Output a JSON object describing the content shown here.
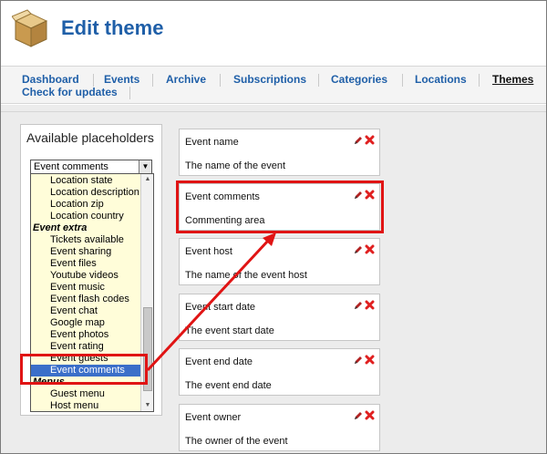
{
  "header": {
    "title": "Edit theme",
    "icon": "box-icon"
  },
  "nav": {
    "items": [
      {
        "label": "Dashboard"
      },
      {
        "label": "Events"
      },
      {
        "label": "Archive"
      },
      {
        "label": "Subscriptions"
      },
      {
        "label": "Categories"
      },
      {
        "label": "Locations"
      },
      {
        "label": "Themes"
      },
      {
        "label": "Check for updates"
      }
    ],
    "active": "Themes"
  },
  "placeholders": {
    "title": "Available placeholders",
    "selected_value": "Event comments",
    "dropdown_items": [
      {
        "label": "Location state",
        "group": false
      },
      {
        "label": "Location description",
        "group": false
      },
      {
        "label": "Location zip",
        "group": false
      },
      {
        "label": "Location country",
        "group": false
      },
      {
        "label": "Event extra",
        "group": true
      },
      {
        "label": "Tickets available",
        "group": false
      },
      {
        "label": "Event sharing",
        "group": false
      },
      {
        "label": "Event files",
        "group": false
      },
      {
        "label": "Youtube videos",
        "group": false
      },
      {
        "label": "Event music",
        "group": false
      },
      {
        "label": "Event flash codes",
        "group": false
      },
      {
        "label": "Event chat",
        "group": false
      },
      {
        "label": "Google map",
        "group": false
      },
      {
        "label": "Event photos",
        "group": false
      },
      {
        "label": "Event rating",
        "group": false
      },
      {
        "label": "Event guests",
        "group": false
      },
      {
        "label": "Event comments",
        "group": false,
        "selected": true
      },
      {
        "label": "Menus",
        "group": true
      },
      {
        "label": "Guest menu",
        "group": false
      },
      {
        "label": "Host menu",
        "group": false
      }
    ]
  },
  "cards": [
    {
      "title": "Event name",
      "description": "The name of the event"
    },
    {
      "title": "Event comments",
      "description": "Commenting area"
    },
    {
      "title": "Event host",
      "description": "The name of the event host"
    },
    {
      "title": "Event start date",
      "description": "The event start date"
    },
    {
      "title": "Event end date",
      "description": "The event end date"
    },
    {
      "title": "Event owner",
      "description": "The owner of the event"
    }
  ],
  "colors": {
    "title_blue": "#1f5fa8",
    "highlight_red": "#e01414",
    "dropdown_bg": "#fffdd9",
    "selected_bg": "#3b6fc9"
  }
}
